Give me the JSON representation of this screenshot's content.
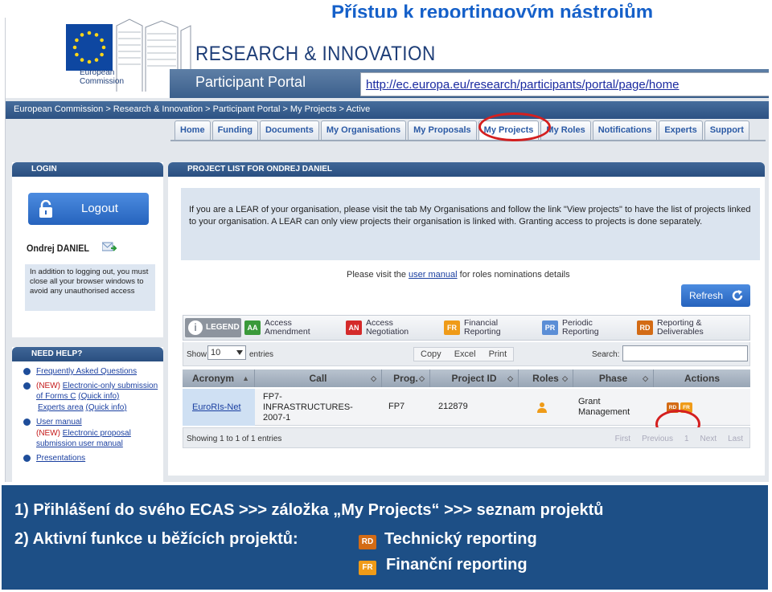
{
  "slide_title": "Přístup k reportingovým nástrojům",
  "header": {
    "logo_text_line1": "European",
    "logo_text_line2": "Commission",
    "site_title": "RESEARCH & INNOVATION",
    "portal_name": "Participant Portal",
    "url": "http://ec.europa.eu/research/participants/portal/page/home"
  },
  "breadcrumb": "European Commission > Research & Innovation > Participant Portal > My Projects > Active",
  "nav": {
    "tabs": [
      "Home",
      "Funding",
      "Documents",
      "My Organisations",
      "My Proposals",
      "My Projects",
      "My Roles",
      "Notifications",
      "Experts",
      "Support"
    ],
    "active": "My Projects"
  },
  "login_panel": {
    "title": "LOGIN",
    "logout_label": "Logout",
    "user_name": "Ondrej DANIEL",
    "note": "In addition to logging out, you must close all your browser windows to avoid any unauthorised access"
  },
  "help_panel": {
    "title": "NEED HELP?",
    "items": [
      {
        "link": "Frequently Asked Questions"
      },
      {
        "new": "(NEW)",
        "link": "Electronic-only submission of Forms C",
        "extra": "(Quick info)"
      },
      {
        "link": "Experts area",
        "extra": "(Quick info)"
      },
      {
        "link": "User manual"
      },
      {
        "new": "(NEW)",
        "link": "Electronic proposal submission user manual"
      },
      {
        "link": "Presentations"
      }
    ]
  },
  "main_panel": {
    "title": "PROJECT LIST FOR ONDREJ DANIEL",
    "lear_note": "If you are a LEAR of your organisation, please visit the tab My Organisations and follow the link \"View projects\" to have the list of projects linked to your organisation. A LEAR can only view projects their organisation is linked with. Granting access to projects is done separately.",
    "visit_prefix": "Please visit the",
    "visit_link": "user manual",
    "visit_suffix": "for roles nominations details",
    "refresh_label": "Refresh"
  },
  "legend": {
    "title": "LEGEND",
    "items": [
      {
        "code": "AA",
        "line1": "Access",
        "line2": "Amendment",
        "color": "#3a9a3a"
      },
      {
        "code": "AN",
        "line1": "Access",
        "line2": "Negotiation",
        "color": "#d42a2a"
      },
      {
        "code": "FR",
        "line1": "Financial",
        "line2": "Reporting",
        "color": "#ef9b18"
      },
      {
        "code": "PR",
        "line1": "Periodic",
        "line2": "Reporting",
        "color": "#5b8ed6"
      },
      {
        "code": "RD",
        "line1": "Reporting &",
        "line2": "Deliverables",
        "color": "#d36b15"
      }
    ]
  },
  "table_controls": {
    "show_label": "Show",
    "page_size": "10",
    "entries_label": "entries",
    "buttons": [
      "Copy",
      "Excel",
      "Print"
    ],
    "search_label": "Search:"
  },
  "table": {
    "columns": [
      "Acronym",
      "Call",
      "Prog.",
      "Project ID",
      "Roles",
      "Phase",
      "Actions"
    ],
    "rows": [
      {
        "acronym": "EuroRIs-Net",
        "call_line1": "FP7-",
        "call_line2": "INFRASTRUCTURES-",
        "call_line3": "2007-1",
        "prog": "FP7",
        "project_id": "212879",
        "phase_line1": "Grant",
        "phase_line2": "Management",
        "actions": [
          "RD",
          "FR"
        ]
      }
    ],
    "footer_info": "Showing 1 to 1 of 1 entries",
    "pager": [
      "First",
      "Previous",
      "1",
      "Next",
      "Last"
    ]
  },
  "info_band": {
    "line1": "1) Přihlášení do svého ECAS >>> záložka „My Projects“ >>> seznam projektů",
    "line2": "2) Aktivní funkce u běžících projektů:",
    "item_rd_code": "RD",
    "item_rd_text": "Technický reporting",
    "item_fr_code": "FR",
    "item_fr_text": "Finanční reporting"
  }
}
